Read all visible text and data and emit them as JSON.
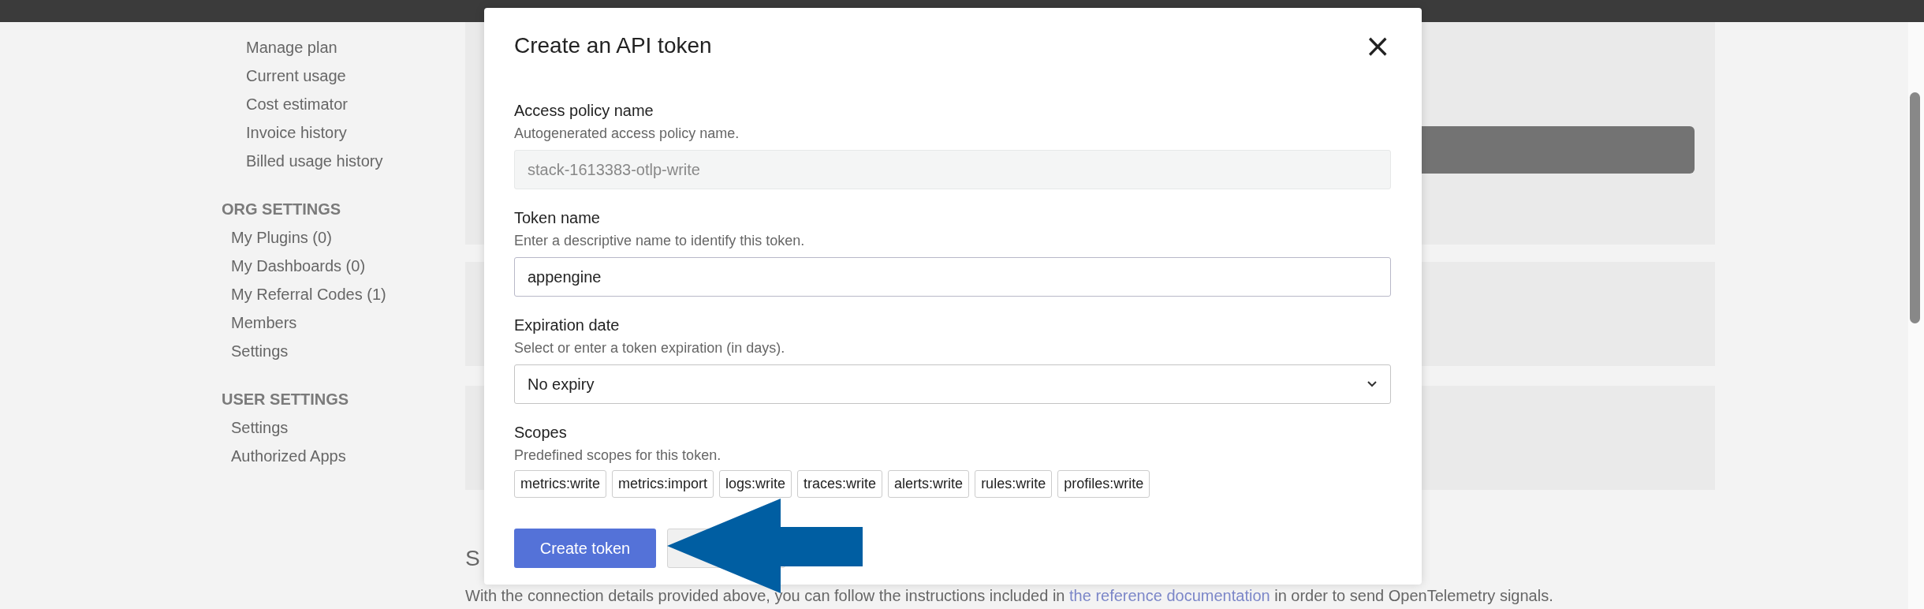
{
  "sidebar": {
    "groups": [
      {
        "kind": "nested",
        "items": [
          "Manage plan",
          "Current usage",
          "Cost estimator",
          "Invoice history",
          "Billed usage history"
        ]
      },
      {
        "kind": "top",
        "heading": "ORG SETTINGS",
        "items": [
          "My Plugins (0)",
          "My Dashboards (0)",
          "My Referral Codes (1)",
          "Members",
          "Settings"
        ]
      },
      {
        "kind": "top",
        "heading": "USER SETTINGS",
        "items": [
          "Settings",
          "Authorized Apps"
        ]
      }
    ]
  },
  "main": {
    "section_heading": "S",
    "paragraph_before": "With the connection details provided above, you can follow the instructions included in ",
    "link": "the reference documentation",
    "paragraph_after": " in order to send OpenTelemetry signals."
  },
  "modal": {
    "title": "Create an API token",
    "close": "×",
    "fields": [
      {
        "kind": "readonly",
        "label": "Access policy name",
        "hint": "Autogenerated access policy name.",
        "value": "stack-1613383-otlp-write"
      },
      {
        "kind": "text",
        "label": "Token name",
        "hint": "Enter a descriptive name to identify this token.",
        "value": "appengine"
      },
      {
        "kind": "select",
        "label": "Expiration date",
        "hint": "Select or enter a token expiration (in days).",
        "value": "No expiry"
      },
      {
        "kind": "chips",
        "label": "Scopes",
        "hint": "Predefined scopes for this token.",
        "chips": [
          "metrics:write",
          "metrics:import",
          "logs:write",
          "traces:write",
          "alerts:write",
          "rules:write",
          "profiles:write"
        ]
      }
    ],
    "buttons": [
      {
        "kind": "primary",
        "label": "Create token"
      },
      {
        "kind": "secondary"
      }
    ]
  }
}
